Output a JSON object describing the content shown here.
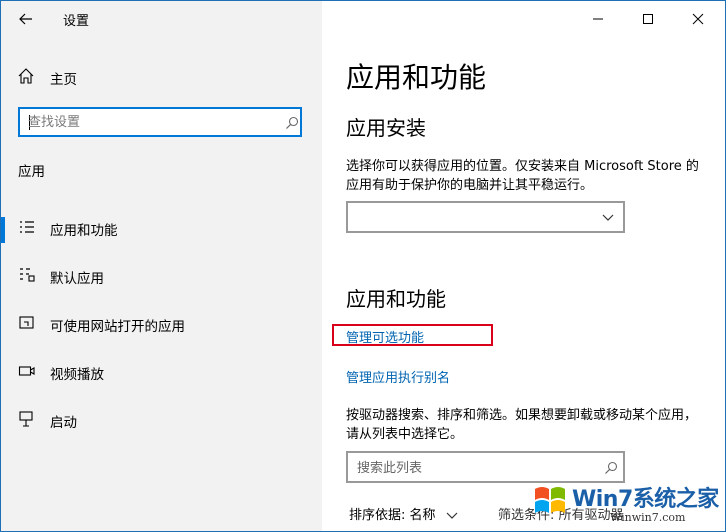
{
  "window": {
    "title": "设置"
  },
  "sidebar": {
    "home_label": "主页",
    "search_placeholder": "查找设置",
    "section_label": "应用",
    "items": [
      {
        "label": "应用和功能",
        "icon": "apps-features-icon",
        "selected": true
      },
      {
        "label": "默认应用",
        "icon": "default-apps-icon",
        "selected": false
      },
      {
        "label": "可使用网站打开的应用",
        "icon": "apps-for-websites-icon",
        "selected": false
      },
      {
        "label": "视频播放",
        "icon": "video-playback-icon",
        "selected": false
      },
      {
        "label": "启动",
        "icon": "startup-icon",
        "selected": false
      }
    ]
  },
  "main": {
    "page_title": "应用和功能",
    "install_heading": "应用安装",
    "install_description": "选择你可以获得应用的位置。仅安装来自 Microsoft Store 的应用有助于保护你的电脑并让其平稳运行。",
    "install_dropdown_value": "",
    "features_heading": "应用和功能",
    "link_optional_features": "管理可选功能",
    "link_app_aliases": "管理应用执行别名",
    "list_description": "按驱动器搜索、排序和筛选。如果想要卸载或移动某个应用，请从列表中选择它。",
    "list_search_placeholder": "搜索此列表",
    "sort_label": "排序依据: 名称",
    "filter_label": "筛选条件: 所有驱动器"
  },
  "watermark": {
    "brand": "Win7系统之家",
    "url": "Winwin7.com"
  },
  "colors": {
    "accent": "#0078d7",
    "link": "#0063b1",
    "highlight": "#d9001b",
    "sidebar_bg": "#f2f2f2"
  }
}
